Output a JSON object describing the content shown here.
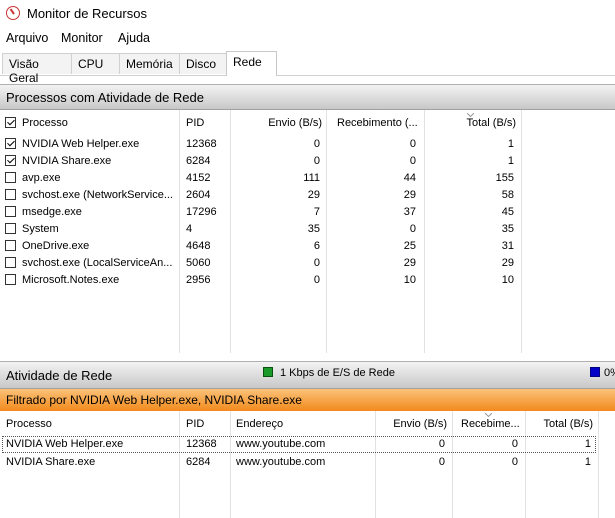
{
  "window": {
    "title": "Monitor de Recursos"
  },
  "menu": [
    "Arquivo",
    "Monitor",
    "Ajuda"
  ],
  "tabs": [
    {
      "label": "Visão Geral",
      "active": false
    },
    {
      "label": "CPU",
      "active": false
    },
    {
      "label": "Memória",
      "active": false
    },
    {
      "label": "Disco",
      "active": false
    },
    {
      "label": "Rede",
      "active": true
    }
  ],
  "processes": {
    "section_title": "Processos com Atividade de Rede",
    "columns": [
      "Processo",
      "PID",
      "Envio (B/s)",
      "Recebimento (...",
      "Total (B/s)"
    ],
    "rows": [
      {
        "checked": true,
        "name": "NVIDIA Web Helper.exe",
        "pid": "12368",
        "send": "0",
        "recv": "0",
        "total": "1"
      },
      {
        "checked": true,
        "name": "NVIDIA Share.exe",
        "pid": "6284",
        "send": "0",
        "recv": "0",
        "total": "1"
      },
      {
        "checked": false,
        "name": "avp.exe",
        "pid": "4152",
        "send": "111",
        "recv": "44",
        "total": "155"
      },
      {
        "checked": false,
        "name": "svchost.exe (NetworkService...",
        "pid": "2604",
        "send": "29",
        "recv": "29",
        "total": "58"
      },
      {
        "checked": false,
        "name": "msedge.exe",
        "pid": "17296",
        "send": "7",
        "recv": "37",
        "total": "45"
      },
      {
        "checked": false,
        "name": "System",
        "pid": "4",
        "send": "35",
        "recv": "0",
        "total": "35"
      },
      {
        "checked": false,
        "name": "OneDrive.exe",
        "pid": "4648",
        "send": "6",
        "recv": "25",
        "total": "31"
      },
      {
        "checked": false,
        "name": "svchost.exe (LocalServiceAn...",
        "pid": "5060",
        "send": "0",
        "recv": "29",
        "total": "29"
      },
      {
        "checked": false,
        "name": "Microsoft.Notes.exe",
        "pid": "2956",
        "send": "0",
        "recv": "10",
        "total": "10"
      }
    ]
  },
  "network_activity": {
    "section_title": "Atividade de Rede",
    "io_label": "1 Kbps de E/S de Rede",
    "usage_label": "0%",
    "filter_text": "Filtrado por NVIDIA Web Helper.exe, NVIDIA Share.exe",
    "columns": [
      "Processo",
      "PID",
      "Endereço",
      "Envio (B/s)",
      "Recebime...",
      "Total (B/s)"
    ],
    "rows": [
      {
        "name": "NVIDIA Web Helper.exe",
        "pid": "12368",
        "address": "www.youtube.com",
        "send": "0",
        "recv": "0",
        "total": "1",
        "selected": true
      },
      {
        "name": "NVIDIA Share.exe",
        "pid": "6284",
        "address": "www.youtube.com",
        "send": "0",
        "recv": "0",
        "total": "1",
        "selected": false
      }
    ]
  },
  "colors": {
    "green_legend": "#1a9a28",
    "blue_legend": "#0000c8",
    "filter_bar": "#f28a1c"
  }
}
